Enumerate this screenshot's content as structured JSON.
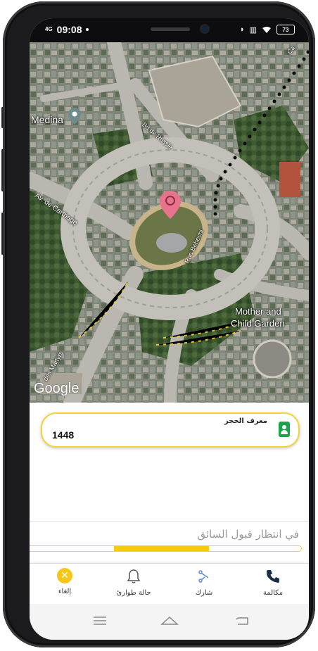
{
  "status_bar": {
    "network": "4G",
    "time": "09:08",
    "battery": "73"
  },
  "map": {
    "labels": {
      "medina": "Medina",
      "bd_de_russie": "Bd de Russie",
      "av_de_carthage": "Av. de Carthage",
      "rue_bebechi": "Rue Bebechi",
      "mother_child_garden_line1": "Mother and",
      "mother_child_garden_line2": "Child Garden",
      "des_martyrs": "des Martyrs",
      "top_road": "Ca"
    },
    "attribution": "Google"
  },
  "booking": {
    "label": "معرف الحجز",
    "id": "1448"
  },
  "waiting_text": "في انتظار قبول السائق",
  "progress": {
    "segment_start": 0.31,
    "segment_end": 0.66
  },
  "actions": [
    {
      "key": "call",
      "label": "مكالمة",
      "icon": "phone-icon"
    },
    {
      "key": "share",
      "label": "شارك",
      "icon": "share-icon"
    },
    {
      "key": "emergency",
      "label": "حالة طوارئ",
      "icon": "bell-icon"
    },
    {
      "key": "cancel",
      "label": "إلغاء",
      "icon": "close-icon",
      "symbol": "✕"
    }
  ],
  "colors": {
    "accent": "#f4cc0d",
    "pin": "#e8738c",
    "badge": "#1aa34a",
    "call": "#1c2f45",
    "share": "#5d8fd6"
  }
}
